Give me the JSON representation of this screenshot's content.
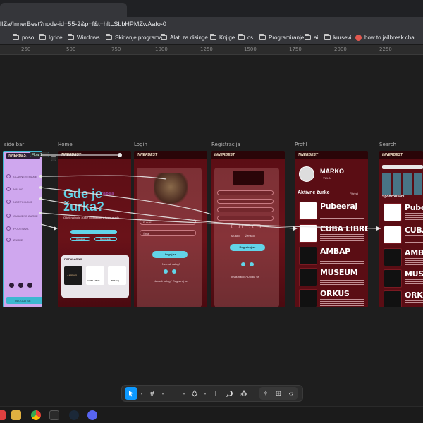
{
  "browser": {
    "url": "lIZa/InnerBest?node-id=55-2&p=f&t=hltLSbbHPMZwAafo-0",
    "bookmarks": [
      "poso",
      "Igrice",
      "Windows",
      "Skidanje programa",
      "Alati za disinge",
      "Knjige",
      "cs",
      "Programiranje",
      "ai",
      "kursevi",
      "how to jailbreak cha..."
    ]
  },
  "ruler": {
    "ticks": [
      "250",
      "500",
      "750",
      "1000",
      "1250",
      "1500",
      "1750",
      "2000",
      "2250"
    ]
  },
  "frames": {
    "side_bar": {
      "label": "side bar",
      "flow_label": "Flow 1",
      "logo": "INNERBEST",
      "counter": "2",
      "items": [
        "GLAVNE STRANE",
        "NALOG",
        "NOTIFIKACIJE",
        "OMILJENE ZURKE",
        "PODESAVA",
        "ZURKE"
      ],
      "bottom": "ULOGUJ SE"
    },
    "home": {
      "label": "Home",
      "logo": "INNERBEST",
      "headline_1": "Gde je",
      "headline_2": "žurka?",
      "badge": "najbolja",
      "subtitle": "Otkrij najbolje žurke i događaje u tvom gradu",
      "btn_login": "Uloguj se",
      "btn_register": "Registracija",
      "popular_title": "POPULARNO",
      "thumbs": [
        "AMBAP",
        "CUBA LIBRE",
        "PUBeraj"
      ]
    },
    "login": {
      "label": "Login",
      "logo": "INNERBEST",
      "field_1": "E-mail",
      "field_2": "Šifra",
      "button": "Uloguj se",
      "alt_text": "Nemaš nalog?",
      "footer": "Nemaš nalog? Registruj se"
    },
    "registracija": {
      "label": "Registracija",
      "logo": "INNERBEST",
      "button": "Registruj se",
      "gender_1": "Muško",
      "gender_2": "Žensko",
      "footer": "Imaš nalog? Uloguj se"
    },
    "profil": {
      "label": "Profil",
      "logo": "INNERBEST",
      "name": "MARKO",
      "surname": "VULIN",
      "section": "Aktivne žurke",
      "filter": "Filtriraj",
      "items": [
        "Pubeeraj",
        "CUBA LIBRE",
        "AMBAP",
        "MUSEUM",
        "ORKUS"
      ]
    },
    "search": {
      "label": "Search",
      "logo": "INNERBEST",
      "section": "Sponzorisani",
      "items": [
        "Pube",
        "CUBA",
        "AMBA",
        "MUSE",
        "ORKU"
      ]
    }
  },
  "toolbar": {
    "tools": [
      "move-tool",
      "frame-tool",
      "shape-tool",
      "pen-tool",
      "text-tool",
      "comment-tool",
      "actions-tool",
      "dev-mode-tool",
      "inspect-tool",
      "code-tool"
    ]
  }
}
